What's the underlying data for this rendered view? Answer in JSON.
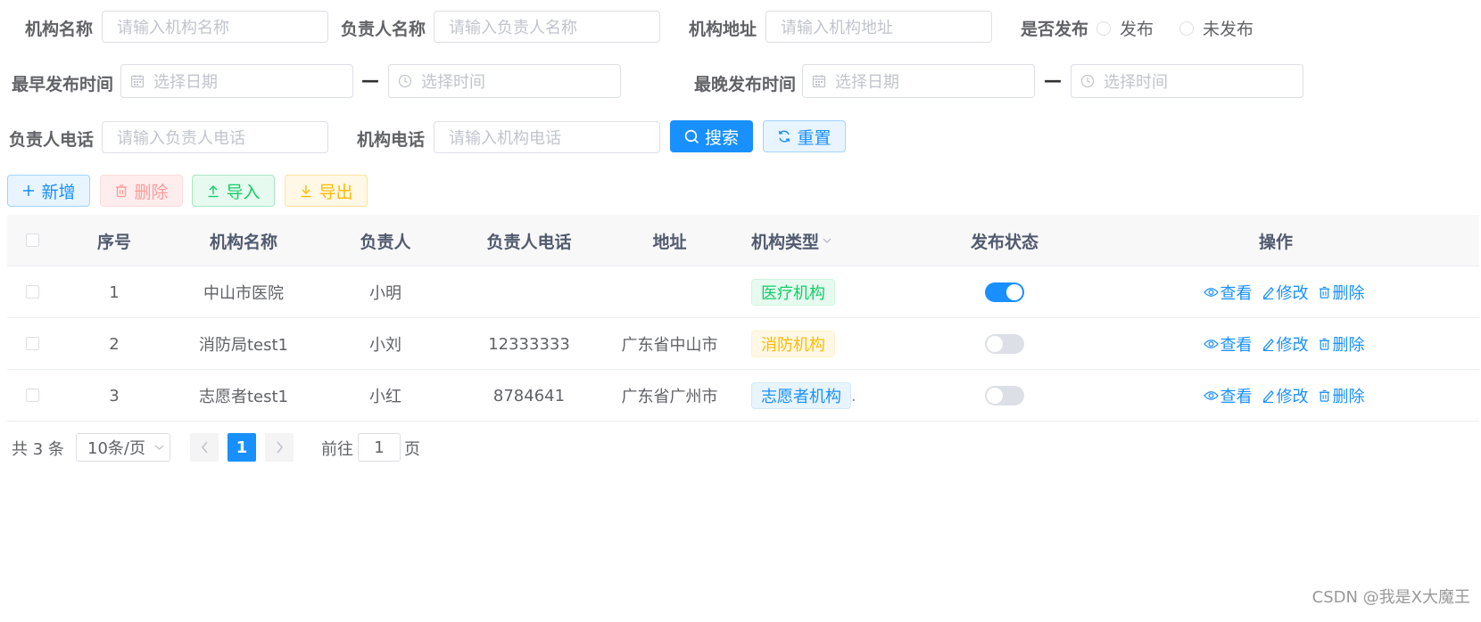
{
  "search_form": {
    "org_name_label": "机构名称",
    "org_name_placeholder": "请输入机构名称",
    "leader_name_label": "负责人名称",
    "leader_name_placeholder": "请输入负责人名称",
    "org_address_label": "机构地址",
    "org_address_placeholder": "请输入机构地址",
    "published_label": "是否发布",
    "published_options": [
      "发布",
      "未发布"
    ],
    "earliest_label": "最早发布时间",
    "latest_label": "最晚发布时间",
    "date_placeholder": "选择日期",
    "time_placeholder": "选择时间",
    "range_separator": "—",
    "leader_phone_label": "负责人电话",
    "leader_phone_placeholder": "请输入负责人电话",
    "org_phone_label": "机构电话",
    "org_phone_placeholder": "请输入机构电话",
    "search_button": "搜索",
    "reset_button": "重置"
  },
  "toolbar": {
    "add": "新增",
    "delete": "删除",
    "import": "导入",
    "export": "导出"
  },
  "table": {
    "columns": [
      "序号",
      "机构名称",
      "负责人",
      "负责人电话",
      "地址",
      "机构类型",
      "发布状态",
      "操作"
    ],
    "actions": [
      "查看",
      "修改",
      "删除"
    ],
    "rows": [
      {
        "index": "1",
        "name": "中山市医院",
        "leader": "小明",
        "phone": "",
        "address": "",
        "type": "医疗机构",
        "type_suffix": "",
        "published": true
      },
      {
        "index": "2",
        "name": "消防局test1",
        "leader": "小刘",
        "phone": "12333333",
        "address": "广东省中山市",
        "type": "消防机构",
        "type_suffix": "",
        "published": false
      },
      {
        "index": "3",
        "name": "志愿者test1",
        "leader": "小红",
        "phone": "8784641",
        "address": "广东省广州市",
        "type": "志愿者机构",
        "type_suffix": ".",
        "published": false
      }
    ]
  },
  "pagination": {
    "total_text": "共 3 条",
    "page_size": "10条/页",
    "current_page": "1",
    "goto_prefix": "前往",
    "goto_value": "1",
    "goto_suffix": "页"
  },
  "watermark": "CSDN @我是X大魔王",
  "colors": {
    "primary": "#1890ff",
    "success": "#13ce66",
    "warning": "#ffba00",
    "danger": "#ff9a9a"
  }
}
